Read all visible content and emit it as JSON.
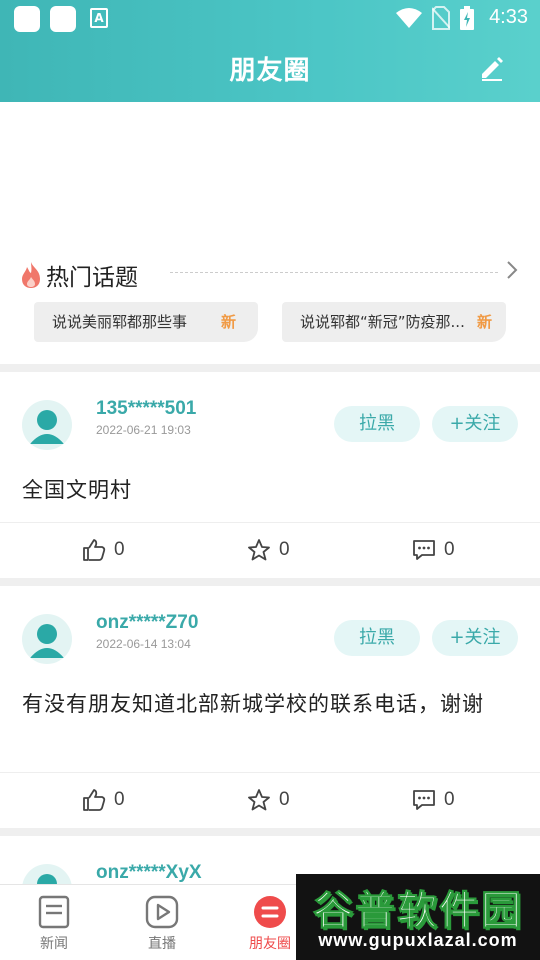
{
  "status_bar": {
    "time": "4:33",
    "indicator": "A"
  },
  "header": {
    "title": "朋友圈"
  },
  "hot_topics": {
    "title": "热门话题",
    "items": [
      {
        "text": "说说美丽郓都那些事",
        "badge": "新"
      },
      {
        "text": "说说郓都“新冠”防疫那...",
        "badge": "新"
      }
    ]
  },
  "posts": [
    {
      "username": "135*****501",
      "date": "2022-06-21 19:03",
      "block_label": "拉黑",
      "follow_label": "+关注",
      "content": "全国文明村",
      "likes": "0",
      "favorites": "0",
      "comments": "0"
    },
    {
      "username": "onz*****Z70",
      "date": "2022-06-14 13:04",
      "block_label": "拉黑",
      "follow_label": "+关注",
      "content": "有没有朋友知道北部新城学校的联系电话，谢谢",
      "likes": "0",
      "favorites": "0",
      "comments": "0"
    },
    {
      "username": "onz*****XyX"
    }
  ],
  "tabbar": {
    "items": [
      {
        "label": "新闻",
        "icon": "news-icon"
      },
      {
        "label": "直播",
        "icon": "play-icon"
      },
      {
        "label": "朋友圈",
        "icon": "moments-icon",
        "active": true
      }
    ]
  },
  "watermark": {
    "name": "谷普软件园",
    "url": "www.gupuxlazal.com"
  },
  "colors": {
    "accent": "#3aa9a9",
    "header_start": "#3fb6b6",
    "header_end": "#5ad0cc",
    "badge": "#f09a45",
    "active_tab": "#ef4b4b"
  }
}
